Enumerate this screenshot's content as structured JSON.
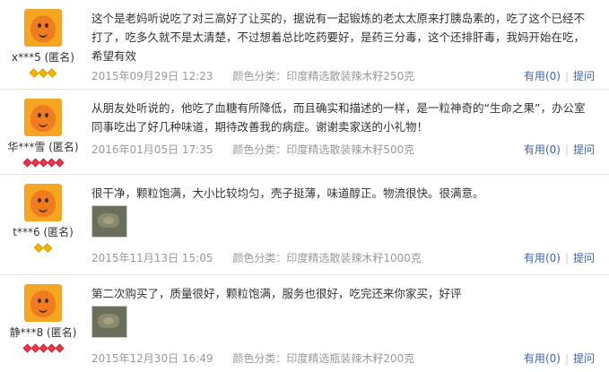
{
  "reviews": [
    {
      "username": "x***5 (匿名)",
      "badge_type": "yellow",
      "badge_count": 3,
      "content": "这个是老妈听说吃了对三高好了让买的，据说有一起锻炼的老太太原来打胰岛素的，吃了这个已经不打了，吃多久就不是太清楚，不过想着总比吃药要好，是药三分毒，这个还排肝毒，我妈开始在吃，希望有效",
      "date": "2015年09月29日",
      "time": "12:23",
      "sku": "颜色分类：印度精选散装辣木籽250克",
      "has_image": false
    },
    {
      "username": "华***雪 (匿名)",
      "badge_type": "red",
      "badge_count": 5,
      "content": "从朋友处听说的，他吃了血糖有所降低，而且确实和描述的一样，是一粒神奇的“生命之果”，办公室同事吃出了好几种味道，期待改善我的病症。谢谢卖家送的小礼物！",
      "date": "2016年01月05日",
      "time": "17:35",
      "sku": "颜色分类：印度精选散装辣木籽500克",
      "has_image": false
    },
    {
      "username": "t***6 (匿名)",
      "badge_type": "yellow",
      "badge_count": 2,
      "content": "很干净，颗粒饱满，大小比较均匀，壳子挺薄，味道醇正。物流很快。很满意。",
      "date": "2015年11月13日",
      "time": "15:05",
      "sku": "颜色分类：印度精选散装辣木籽1000克",
      "has_image": true
    },
    {
      "username": "静***8 (匿名)",
      "badge_type": "red",
      "badge_count": 5,
      "content": "第二次购买了，质量很好，颗粒饱满，服务也很好，吃完还来你家买，好评",
      "date": "2015年12月30日",
      "time": "16:49",
      "sku": "颜色分类：印度精选瓶装辣木籽200克",
      "has_image": true
    }
  ],
  "actions": {
    "useful_label": "有用",
    "useful_count": "(0)",
    "question_label": "提问"
  },
  "colors": {
    "link": "#3c64b4",
    "meta": "#999999",
    "badge_yellow": "#f7b500",
    "badge_red": "#e8384c",
    "avatar": "#f07c22"
  }
}
